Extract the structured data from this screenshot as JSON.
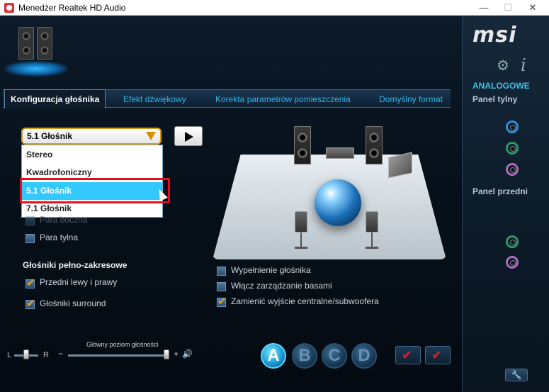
{
  "window": {
    "title": "Menedżer Realtek HD Audio",
    "min": "—",
    "max": "☐",
    "close": "✕"
  },
  "brand": {
    "logo": "msi"
  },
  "tabs": [
    {
      "label": "Konfiguracja głośnika",
      "active": true
    },
    {
      "label": "Efekt dźwiękowy"
    },
    {
      "label": "Korekta parametrów pomieszczenia"
    },
    {
      "label": "Domyślny format"
    }
  ],
  "config": {
    "selected": "5.1 Głośnik",
    "options": [
      "Stereo",
      "Kwadrofoniczny",
      "5.1 Głośnik",
      "7.1 Głośnik"
    ]
  },
  "optional_speakers": [
    {
      "label": "Para boczna",
      "checked": false,
      "enabled": false
    },
    {
      "label": "Para tylna",
      "checked": false,
      "enabled": true
    }
  ],
  "fullrange": {
    "title": "Głośniki pełno-zakresowe",
    "items": [
      {
        "label": "Przedni lewy i prawy",
        "checked": true
      },
      {
        "label": "Głośniki surround",
        "checked": true
      }
    ]
  },
  "options_right": [
    {
      "label": "Wypełnienie głośnika",
      "checked": false
    },
    {
      "label": "Włącz zarządzanie basami",
      "checked": false
    },
    {
      "label": "Zamienić wyjście centralne/subwoofera",
      "checked": true
    }
  ],
  "volume": {
    "label": "Główny poziom głośności",
    "balance_left": "L",
    "balance_right": "R",
    "minus": "−",
    "plus": "+",
    "speaker_symbol": "🔊"
  },
  "profiles": [
    "A",
    "B",
    "C",
    "D"
  ],
  "sidebar": {
    "header": "ANALOGOWE",
    "rear_panel": "Panel tylny",
    "front_panel": "Panel przedni",
    "colors": {
      "blue": "#2f8fe0",
      "green": "#2e9a6a",
      "pink": "#b06bc0"
    }
  }
}
